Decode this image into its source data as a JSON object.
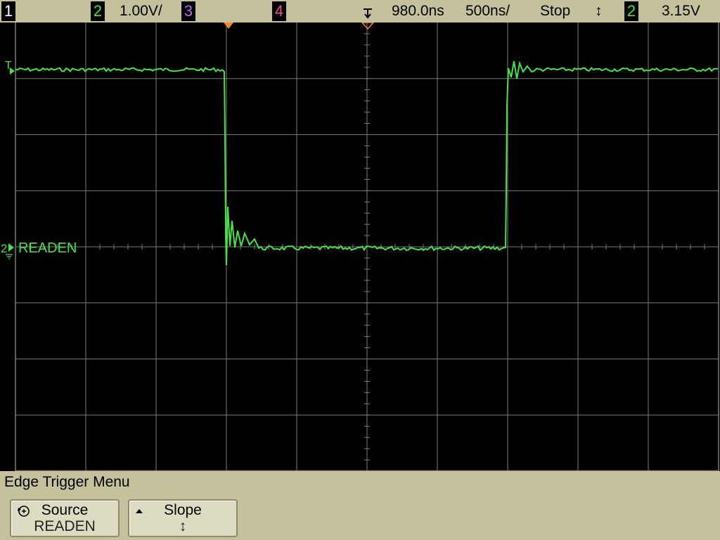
{
  "topbar": {
    "ch1_label": "1",
    "ch2_label": "2",
    "ch2_scale": "1.00V/",
    "ch3_label": "3",
    "ch4_label": "4",
    "trigger_delay": "980.0ns",
    "timebase": "500ns/",
    "run_state": "Stop",
    "trigger_level_arrow": "↕",
    "trigger_source": "2",
    "trigger_level": "3.15V"
  },
  "screen": {
    "trigger_marker": "T",
    "channel_marker": "2",
    "channel_label": "READEN"
  },
  "menu": {
    "title": "Edge Trigger Menu",
    "source_label": "Source",
    "source_value": "READEN",
    "slope_label": "Slope",
    "slope_value": "↕"
  },
  "colors": {
    "bezel": "#c5c19c",
    "trace": "#49e04c",
    "grid": "#7a7a7a",
    "marker": "#f08a2a"
  }
}
